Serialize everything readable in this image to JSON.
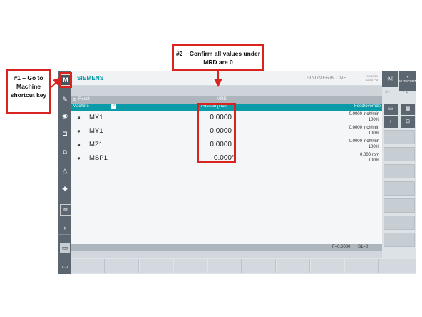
{
  "callouts": {
    "step1": "#1 – Go to Machine shortcut key",
    "step2": "#2 – Confirm all values under MRD are 0"
  },
  "header": {
    "logo": "SIEMENS",
    "product": "SINUMERIK ONE",
    "date": "09/13/21",
    "time": "12:50 PM"
  },
  "status_bar": {
    "reset_label": "Reset",
    "mode": "MRD"
  },
  "axis_header": {
    "machine_label": "Machine",
    "position_label": "Position [inch]",
    "feed_label": "Feed/override"
  },
  "axes": [
    {
      "name": "MX1",
      "position": "0.0000",
      "feed": "0.0000 inch/min",
      "override": "100%"
    },
    {
      "name": "MY1",
      "position": "0.0000",
      "feed": "0.0000 inch/min",
      "override": "100%"
    },
    {
      "name": "MZ1",
      "position": "0.0000",
      "feed": "0.0000 inch/min",
      "override": "100%"
    },
    {
      "name": "MSP1",
      "position": "0.000",
      "unit_glyph": "°",
      "feed": "0.000 rpm",
      "override": "100%"
    }
  ],
  "footer": {
    "feed_status": "F=0.0000",
    "spindle_status": "S1=0"
  },
  "right_keys": {
    "report_label": "M REPORT"
  },
  "left_keys": {
    "machine_icon": "M",
    "more_arrow": "›"
  }
}
